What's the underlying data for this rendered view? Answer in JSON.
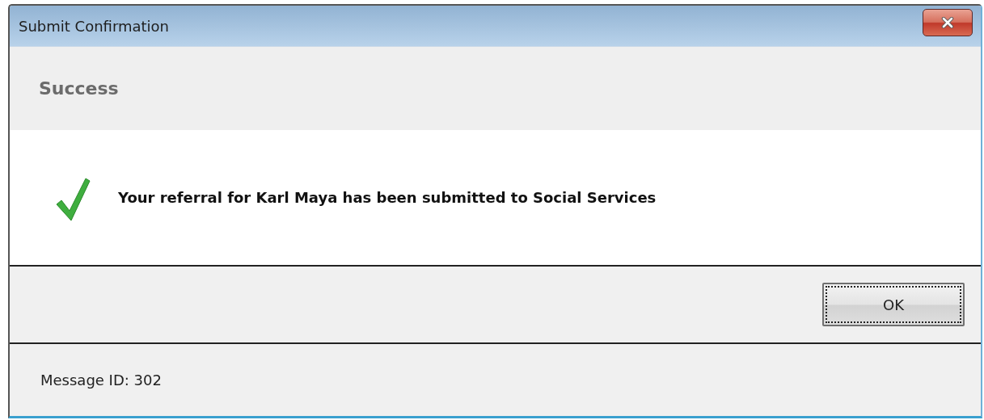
{
  "window": {
    "title": "Submit Confirmation"
  },
  "header": {
    "title": "Success"
  },
  "message": {
    "kind": "success",
    "text": "Your referral for Karl Maya has been submitted to Social Services"
  },
  "buttons": [
    {
      "label": "OK",
      "focused": true
    }
  ],
  "status_bar": {
    "text": "Message ID: 302"
  }
}
